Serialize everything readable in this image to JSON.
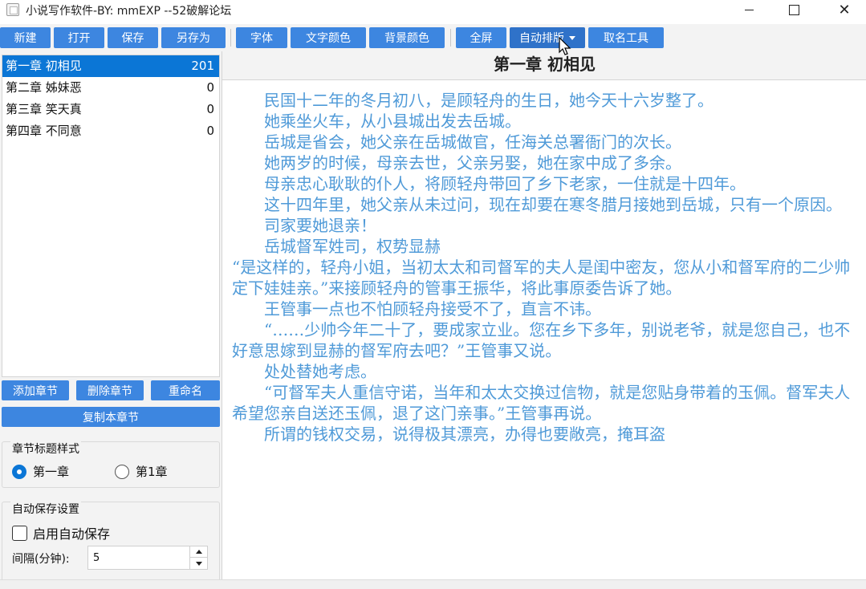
{
  "window": {
    "title": "小说写作软件-BY: mmEXP --52破解论坛",
    "minimize_icon": "minimize-icon",
    "maximize_icon": "maximize-icon",
    "close_icon": "close-icon"
  },
  "toolbar": {
    "new": "新建",
    "open": "打开",
    "save": "保存",
    "save_as": "另存为",
    "font": "字体",
    "text_color": "文字颜色",
    "bg_color": "背景颜色",
    "fullscreen": "全屏",
    "auto_layout": "自动排版",
    "naming_tool": "取名工具"
  },
  "chapters": [
    {
      "title": "第一章 初相见",
      "count": "201"
    },
    {
      "title": "第二章 姊妹恶",
      "count": "0"
    },
    {
      "title": "第三章 笑天真",
      "count": "0"
    },
    {
      "title": "第四章 不同意",
      "count": "0"
    }
  ],
  "chapter_actions": {
    "add": "添加章节",
    "delete": "删除章节",
    "rename": "重命名",
    "copy": "复制本章节"
  },
  "title_style": {
    "label": "章节标题样式",
    "option1": "第一章",
    "option2": "第1章",
    "selected": "第一章"
  },
  "autosave": {
    "label": "自动保存设置",
    "enable_label": "启用自动保存",
    "enabled": false,
    "interval_label": "间隔(分钟):",
    "interval_value": "5"
  },
  "editor": {
    "chapter_title": "第一章  初相见",
    "text_color": "#4f9ad8",
    "paragraphs": [
      "　　民国十二年的冬月初八，是顾轻舟的生日，她今天十六岁整了。",
      "　　她乘坐火车，从小县城出发去岳城。",
      "　　岳城是省会，她父亲在岳城做官，任海关总署衙门的次长。",
      "　　她两岁的时候，母亲去世，父亲另娶，她在家中成了多余。",
      "　　母亲忠心耿耿的仆人，将顾轻舟带回了乡下老家，一住就是十四年。",
      "　　这十四年里，她父亲从未过问，现在却要在寒冬腊月接她到岳城，只有一个原因。",
      "　　司家要她退亲！",
      "　　岳城督军姓司，权势显赫",
      "“是这样的，轻舟小姐，当初太太和司督军的夫人是闺中密友，您从小和督军府的二少帅定下娃娃亲。”来接顾轻舟的管事王振华，将此事原委告诉了她。",
      "　　王管事一点也不怕顾轻舟接受不了，直言不讳。",
      "　　“……少帅今年二十了，要成家立业。您在乡下多年，别说老爷，就是您自己，也不好意思嫁到显赫的督军府去吧？”王管事又说。",
      "　　处处替她考虑。",
      "　　“可督军夫人重信守诺，当年和太太交换过信物，就是您贴身带着的玉佩。督军夫人希望您亲自送还玉佩，退了这门亲事。”王管事再说。",
      "　　所谓的钱权交易，说得极其漂亮，办得也要敞亮，掩耳盗"
    ]
  }
}
